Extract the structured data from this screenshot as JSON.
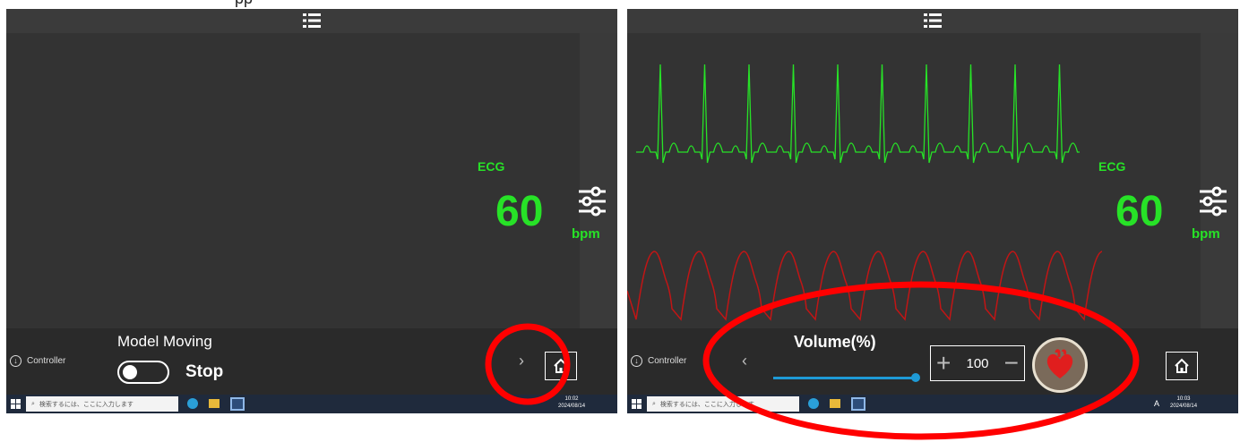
{
  "left_panel": {
    "ecg_label": "ECG",
    "heart_rate": "60",
    "bpm_label": "bpm",
    "controller_label": "Controller",
    "model_moving_title": "Model Moving",
    "toggle_state_label": "Stop",
    "next_arrow": "›",
    "taskbar": {
      "search_placeholder": "検索するには、ここに入力します",
      "clock_time": "10:02",
      "clock_date": "2024/08/14"
    }
  },
  "right_panel": {
    "ecg_label": "ECG",
    "heart_rate": "60",
    "bpm_label": "bpm",
    "controller_label": "Controller",
    "prev_arrow": "‹",
    "volume_title": "Volume(%)",
    "volume_slider": {
      "value_percent": 100
    },
    "volume_value": "100",
    "plus_symbol": "+",
    "minus_symbol": "−",
    "taskbar": {
      "search_placeholder": "検索するには、ここに入力します",
      "ime_indicator": "A",
      "clock_time": "10:03",
      "clock_date": "2024/08/14"
    }
  },
  "colors": {
    "ecg_green": "#27e227",
    "pulse_red": "#c21515",
    "annotation_red": "#ff0000",
    "slider_blue": "#1e9ad6",
    "panel_bg": "#333333"
  },
  "icons": [
    "menu-list-icon",
    "sliders-settings-icon",
    "home-icon",
    "heart-icon",
    "controller-down-icon",
    "windows-start-icon",
    "search-icon",
    "edge-icon",
    "file-explorer-icon",
    "app-icon"
  ]
}
